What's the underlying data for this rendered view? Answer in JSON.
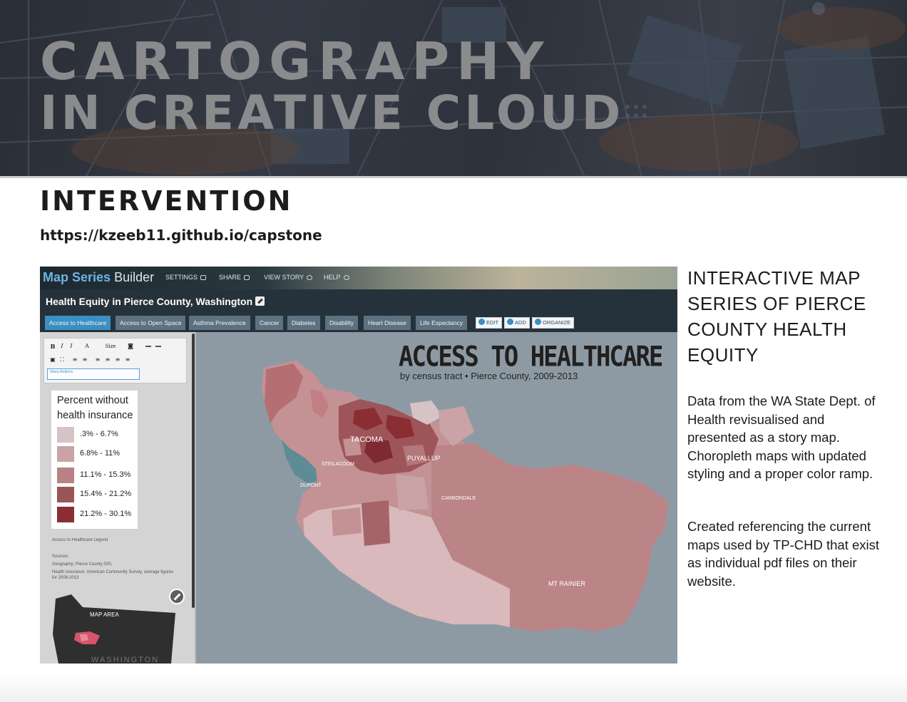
{
  "banner": {
    "title_line1": "CARTOGRAPHY",
    "title_line2": "IN CREATIVE CLOUD"
  },
  "section": {
    "heading": "INTERVENTION",
    "url": "https://kzeeb11.github.io/capstone"
  },
  "builder": {
    "brand_bold": "Map Series",
    "brand_light": "Builder",
    "menu": [
      "SETTINGS",
      "SHARE",
      "VIEW STORY",
      "HELP"
    ],
    "story_title": "Health Equity in Pierce County, Washington",
    "tabs": [
      "Access to Healthcare",
      "Open Space",
      "Asthma Prevalence",
      "Cancer",
      "Diabetes",
      "Disability",
      "Heart Disease",
      "Life Expectancy"
    ],
    "tab_prefix": "Access to ",
    "active_tab": 0,
    "tools": [
      "EDIT",
      "ADD",
      "ORGANIZE"
    ],
    "editor": {
      "size_label": "Size",
      "story_actions": "Story Actions"
    },
    "legend": {
      "title": "Percent without health insurance",
      "items": [
        {
          "label": ".3% - 6.7%",
          "color": "#d6c3c5"
        },
        {
          "label": "6.8% - 11%",
          "color": "#c9a3a6"
        },
        {
          "label": "11.1% - 15.3%",
          "color": "#b98184"
        },
        {
          "label": "15.4% - 21.2%",
          "color": "#9b5559"
        },
        {
          "label": "21.2% - 30.1%",
          "color": "#8a2e34"
        }
      ]
    },
    "caption": {
      "legend_name": "Access to Healthcare Legend",
      "sources_label": "Sources:",
      "geography": "Geography: Pierce County GIS;",
      "insurance": "Health Insurance: American Community Survey, average figures for 2009-2013"
    },
    "inset": {
      "map_area": "MAP AREA",
      "state": "WASHINGTON"
    },
    "map": {
      "title": "ACCESS TO HEALTHCARE",
      "subtitle": "by census tract • Pierce County, 2009-2013",
      "places": [
        "TACOMA",
        "PUYALLUP",
        "STEILACOOM",
        "DUPONT",
        "CARBONDALE",
        "MT RAINIER"
      ]
    }
  },
  "description": {
    "title": "INTERACTIVE MAP SERIES OF PIERCE COUNTY HEALTH EQUITY",
    "paragraph1": "Data from the WA State Dept. of Health revisualised and presented as a story map. Choropleth maps with updated styling and a proper color ramp.",
    "paragraph2": "Created referencing the current maps used by TP-CHD that exist as individual pdf files on their website."
  }
}
